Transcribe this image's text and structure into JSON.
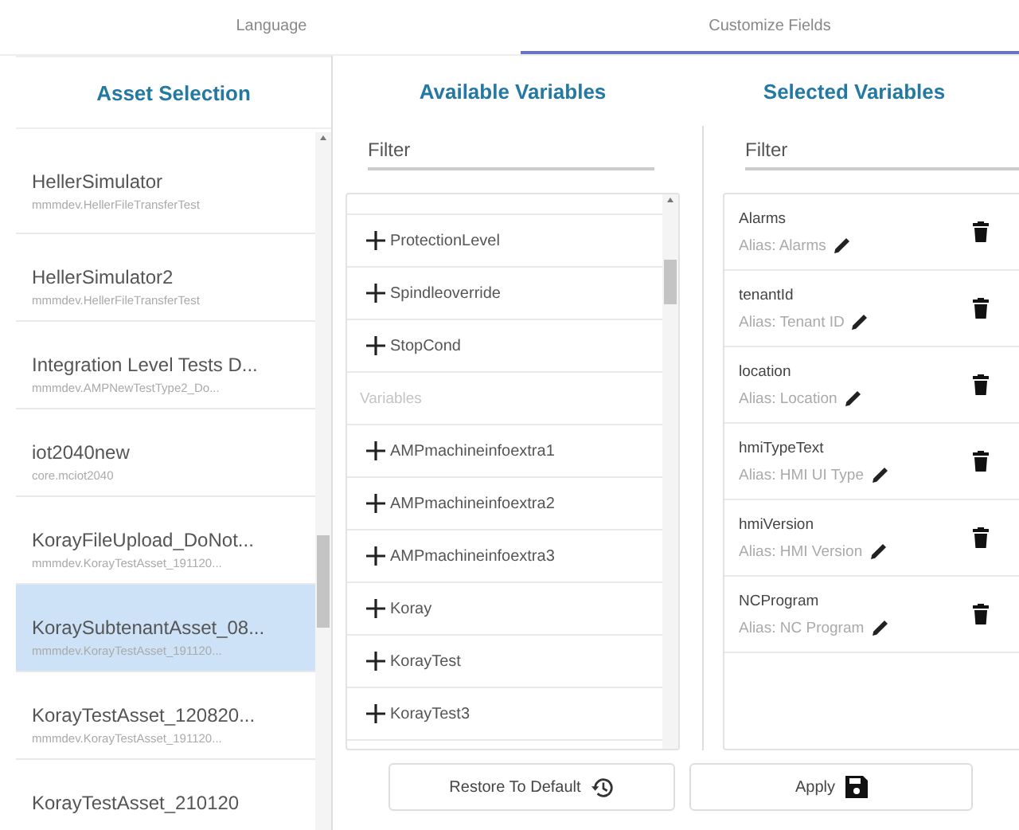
{
  "tabs": [
    {
      "label": "Language",
      "selected": false
    },
    {
      "label": "Customize Fields",
      "selected": true
    }
  ],
  "asset_selection": {
    "title": "Asset Selection",
    "items": [
      {
        "name": "HellerSimulator",
        "path": "mmmdev.HellerFileTransferTest",
        "selected": false
      },
      {
        "name": "HellerSimulator2",
        "path": "mmmdev.HellerFileTransferTest",
        "selected": false
      },
      {
        "name": "Integration Level Tests D...",
        "path": "mmmdev.AMPNewTestType2_Do...",
        "selected": false
      },
      {
        "name": "iot2040new",
        "path": "core.mciot2040",
        "selected": false
      },
      {
        "name": "KorayFileUpload_DoNot...",
        "path": "mmmdev.KorayTestAsset_191120...",
        "selected": false
      },
      {
        "name": "KoraySubtenantAsset_08...",
        "path": "mmmdev.KorayTestAsset_191120...",
        "selected": true
      },
      {
        "name": "KorayTestAsset_120820...",
        "path": "mmmdev.KorayTestAsset_191120...",
        "selected": false
      },
      {
        "name": "KorayTestAsset_210120",
        "selected": false
      }
    ]
  },
  "available_variables": {
    "title": "Available Variables",
    "filter": {
      "placeholder": "Filter"
    },
    "items": [
      {
        "kind": "variable",
        "label": "ProtectionLevel"
      },
      {
        "kind": "variable",
        "label": "Spindleoverride"
      },
      {
        "kind": "variable",
        "label": "StopCond"
      },
      {
        "kind": "group",
        "label": "Variables"
      },
      {
        "kind": "variable",
        "label": "AMPmachineinfoextra1"
      },
      {
        "kind": "variable",
        "label": "AMPmachineinfoextra2"
      },
      {
        "kind": "variable",
        "label": "AMPmachineinfoextra3"
      },
      {
        "kind": "variable",
        "label": "Koray"
      },
      {
        "kind": "variable",
        "label": "KorayTest"
      },
      {
        "kind": "variable",
        "label": "KorayTest3"
      }
    ],
    "button": "Restore To Default"
  },
  "selected_variables": {
    "title": "Selected Variables",
    "filter": {
      "placeholder": "Filter"
    },
    "items": [
      {
        "name": "Alarms",
        "alias": "Alias: Alarms"
      },
      {
        "name": "tenantId",
        "alias": "Alias: Tenant ID"
      },
      {
        "name": "location",
        "alias": "Alias: Location"
      },
      {
        "name": "hmiTypeText",
        "alias": "Alias: HMI UI Type"
      },
      {
        "name": "hmiVersion",
        "alias": "Alias: HMI Version"
      },
      {
        "name": "NCProgram",
        "alias": "Alias: NC Program"
      }
    ],
    "button": "Apply"
  }
}
